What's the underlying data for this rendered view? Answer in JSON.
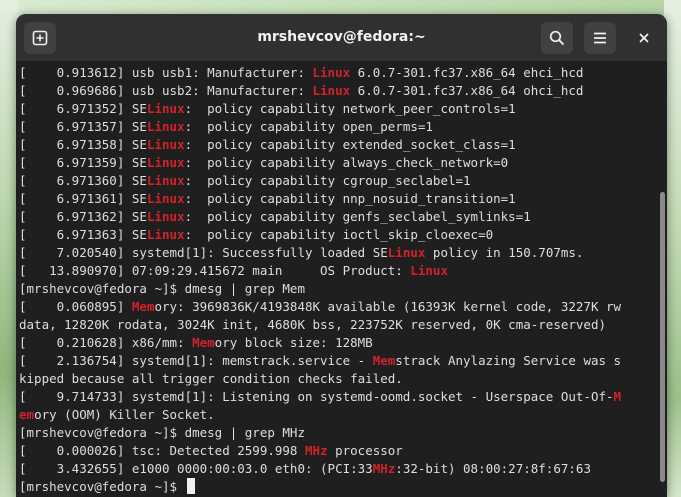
{
  "window": {
    "title": "mrshevcov@fedora:~"
  },
  "colors": {
    "highlight": "#d0222c",
    "text": "#dedede",
    "background": "#1f1f1f"
  },
  "icons": {
    "new_tab": "new-tab-icon",
    "search": "search-icon",
    "menu": "hamburger-menu-icon",
    "close": "close-icon"
  },
  "terminal": {
    "lines": [
      [
        {
          "t": "[    0.913612] usb usb1: Manufacturer: "
        },
        {
          "t": "Linux",
          "h": true
        },
        {
          "t": " 6.0.7-301.fc37.x86_64 ehci_hcd"
        }
      ],
      [
        {
          "t": "[    0.969686] usb usb2: Manufacturer: "
        },
        {
          "t": "Linux",
          "h": true
        },
        {
          "t": " 6.0.7-301.fc37.x86_64 ohci_hcd"
        }
      ],
      [
        {
          "t": "[    6.971352] SE"
        },
        {
          "t": "Linux",
          "h": true
        },
        {
          "t": ":  policy capability network_peer_controls=1"
        }
      ],
      [
        {
          "t": "[    6.971357] SE"
        },
        {
          "t": "Linux",
          "h": true
        },
        {
          "t": ":  policy capability open_perms=1"
        }
      ],
      [
        {
          "t": "[    6.971358] SE"
        },
        {
          "t": "Linux",
          "h": true
        },
        {
          "t": ":  policy capability extended_socket_class=1"
        }
      ],
      [
        {
          "t": "[    6.971359] SE"
        },
        {
          "t": "Linux",
          "h": true
        },
        {
          "t": ":  policy capability always_check_network=0"
        }
      ],
      [
        {
          "t": "[    6.971360] SE"
        },
        {
          "t": "Linux",
          "h": true
        },
        {
          "t": ":  policy capability cgroup_seclabel=1"
        }
      ],
      [
        {
          "t": "[    6.971361] SE"
        },
        {
          "t": "Linux",
          "h": true
        },
        {
          "t": ":  policy capability nnp_nosuid_transition=1"
        }
      ],
      [
        {
          "t": "[    6.971362] SE"
        },
        {
          "t": "Linux",
          "h": true
        },
        {
          "t": ":  policy capability genfs_seclabel_symlinks=1"
        }
      ],
      [
        {
          "t": "[    6.971363] SE"
        },
        {
          "t": "Linux",
          "h": true
        },
        {
          "t": ":  policy capability ioctl_skip_cloexec=0"
        }
      ],
      [
        {
          "t": "[    7.020540] systemd[1]: Successfully loaded SE"
        },
        {
          "t": "Linux",
          "h": true
        },
        {
          "t": " policy in 150.707ms."
        }
      ],
      [
        {
          "t": "[   13.890970] 07:09:29.415672 main     OS Product: "
        },
        {
          "t": "Linux",
          "h": true
        }
      ],
      [
        {
          "t": "[mrshevcov@fedora ~]$ dmesg | grep Mem"
        }
      ],
      [
        {
          "t": "[    0.060895] "
        },
        {
          "t": "Mem",
          "h": true
        },
        {
          "t": "ory: 3969836K/4193848K available (16393K kernel code, 3227K rw"
        }
      ],
      [
        {
          "t": "data, 12820K rodata, 3024K init, 4680K bss, 223752K reserved, 0K cma-reserved)"
        }
      ],
      [
        {
          "t": "[    0.210628] x86/mm: "
        },
        {
          "t": "Mem",
          "h": true
        },
        {
          "t": "ory block size: 128MB"
        }
      ],
      [
        {
          "t": "[    2.136754] systemd[1]: memstrack.service - "
        },
        {
          "t": "Mem",
          "h": true
        },
        {
          "t": "strack Anylazing Service was s"
        }
      ],
      [
        {
          "t": "kipped because all trigger condition checks failed."
        }
      ],
      [
        {
          "t": "[    9.714733] systemd[1]: Listening on systemd-oomd.socket - Userspace Out-Of-"
        },
        {
          "t": "M",
          "h": true
        }
      ],
      [
        {
          "t": "em",
          "h": true
        },
        {
          "t": "ory (OOM) Killer Socket."
        }
      ],
      [
        {
          "t": "[mrshevcov@fedora ~]$ dmesg | grep MHz"
        }
      ],
      [
        {
          "t": "[    0.000026] tsc: Detected 2599.998 "
        },
        {
          "t": "MHz",
          "h": true
        },
        {
          "t": " processor"
        }
      ],
      [
        {
          "t": "[    3.432655] e1000 0000:00:03.0 eth0: (PCI:33"
        },
        {
          "t": "MHz",
          "h": true
        },
        {
          "t": ":32-bit) 08:00:27:8f:67:63"
        }
      ]
    ],
    "prompt": "[mrshevcov@fedora ~]$ "
  }
}
